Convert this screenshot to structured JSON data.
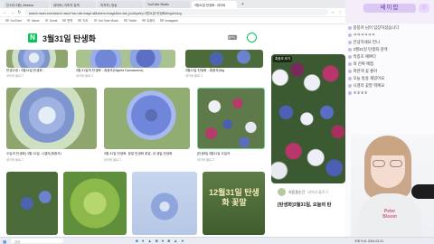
{
  "browser": {
    "tabs": [
      {
        "label": "인스타그램 | Afreeca"
      },
      {
        "label": "네이버 | 이미지 검색"
      },
      {
        "label": "치지직 | 방송"
      },
      {
        "label": "YouTube Studio"
      },
      {
        "label": "3월31일 탄생화 : 네이버"
      }
    ],
    "new_tab": "+",
    "url": "search.naver.com/search.naver?ssc=tab.image.all&where=image&sm=tab_jum&query=3월31일+탄생화#imgId=blog",
    "bookmarks": [
      {
        "label": "YouTube"
      },
      {
        "label": "Naver"
      },
      {
        "label": "Gmail"
      },
      {
        "label": "번역"
      },
      {
        "label": "지도"
      },
      {
        "label": "YouTube Music"
      },
      {
        "label": "Twitch"
      },
      {
        "label": "트위터"
      },
      {
        "label": "Instagram"
      }
    ]
  },
  "naver": {
    "logo": "N",
    "query": "3월31일 탄생화"
  },
  "grid": {
    "row1": [
      {
        "caption": "탄생수정 / 3월31일 탄생화 -",
        "source": "네이버 블로그"
      },
      {
        "caption": "3월 31일의 탄생화 - 흑종초(Nigella Damascena)",
        "source": "네이버 블로그"
      },
      {
        "caption": "3월31일 탄생화 - 흑종초(Nig",
        "source": "네이버 블로그"
      }
    ],
    "row2": [
      {
        "caption": "오늘의 탄생화) 3월 31일, 니겔라(흑종초)",
        "source": "네이버 블로그"
      },
      {
        "caption": "3월 31일 탄생화, 꽃말 탄생화 꽃말, 내 생일 탄생화",
        "source": "네이버 블로그"
      },
      {
        "caption": "[탄생화] 3월31일 오늘의",
        "source": "네이버 블로그"
      }
    ],
    "row3": [
      {
        "caption": "",
        "source": ""
      },
      {
        "caption": "",
        "source": ""
      },
      {
        "caption": "",
        "source": ""
      },
      {
        "caption": "12월31일 탄생화 꽃말",
        "source": ""
      }
    ]
  },
  "featured": {
    "badge": "흑종초 보기",
    "author": "처음종순간",
    "author_source": "네이버 블로그",
    "title": "[탄생화]3월31일, 오늘의 탄"
  },
  "chat": {
    "nickname": "쌔이랍",
    "lines": [
      "붕붕카 님이 입장하셨습니다",
      "ㅋㅋㅋㅋㅋㅋ",
      "안녕하세요 언니",
      "3월31일 탄생화 검색",
      "흑종초 예쁘다",
      "와 진짜 예쁨",
      "파란색 꽃 좋아",
      "오늘 방송 재밌어요",
      "니겔라 꽃말 뭐예요",
      "ㅎㅎㅎㅎ"
    ],
    "shirt_text": "Peter Bloom"
  },
  "taskbar": {
    "search_placeholder": "검색",
    "time": "오후 9:41",
    "date": "2024-03-31"
  }
}
